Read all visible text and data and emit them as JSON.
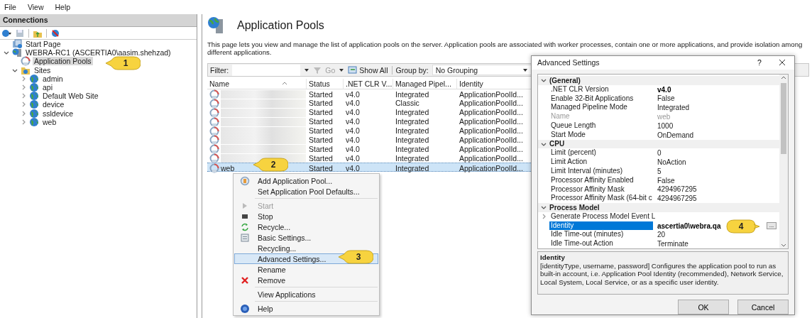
{
  "menu_bar": [
    "File",
    "View",
    "Help"
  ],
  "connections": {
    "title": "Connections",
    "tree": [
      {
        "label": "Start Page",
        "kind": "leaf",
        "selected": false
      },
      {
        "label": "WEBRA-RC1 (ASCERTIA0\\aasim.shehzad)",
        "kind": "node",
        "expanded": true,
        "selected": false,
        "children": [
          {
            "label": "Application Pools",
            "kind": "leaf",
            "selected": true
          },
          {
            "label": "Sites",
            "kind": "node",
            "expanded": true,
            "selected": false,
            "children": [
              {
                "label": "admin",
                "kind": "node",
                "expanded": false,
                "selected": false
              },
              {
                "label": "api",
                "kind": "node",
                "expanded": false,
                "selected": false
              },
              {
                "label": "Default Web Site",
                "kind": "node",
                "expanded": false,
                "selected": false
              },
              {
                "label": "device",
                "kind": "node",
                "expanded": false,
                "selected": false
              },
              {
                "label": "ssldevice",
                "kind": "node",
                "expanded": false,
                "selected": false
              },
              {
                "label": "web",
                "kind": "node",
                "expanded": false,
                "selected": false
              }
            ]
          }
        ]
      }
    ]
  },
  "page": {
    "title": "Application Pools",
    "description": "This page lets you view and manage the list of application pools on the server. Application pools are associated with worker processes, contain one or more applications, and provide isolation among different applications.",
    "filter": {
      "label": "Filter:",
      "go": "Go",
      "show_all": "Show All",
      "group_by_label": "Group by:",
      "group_by": "No Grouping"
    },
    "table": {
      "columns": [
        "Name",
        "Status",
        ".NET CLR V...",
        "Managed Pipel...",
        "Identity"
      ],
      "rows": [
        {
          "status": "Started",
          "clr": "v4.0",
          "pipeline": "Integrated",
          "identity": "ApplicationPoolId...",
          "selected": false
        },
        {
          "status": "Started",
          "clr": "v4.0",
          "pipeline": "Classic",
          "identity": "ApplicationPoolId...",
          "selected": false
        },
        {
          "status": "Started",
          "clr": "v4.0",
          "pipeline": "Integrated",
          "identity": "ApplicationPoolId...",
          "selected": false
        },
        {
          "status": "Started",
          "clr": "v4.0",
          "pipeline": "Integrated",
          "identity": "ApplicationPoolId...",
          "selected": false
        },
        {
          "status": "Started",
          "clr": "v4.0",
          "pipeline": "Integrated",
          "identity": "ApplicationPoolId...",
          "selected": false
        },
        {
          "status": "Started",
          "clr": "v4.0",
          "pipeline": "Integrated",
          "identity": "ApplicationPoolId...",
          "selected": false
        },
        {
          "status": "Started",
          "clr": "v4.0",
          "pipeline": "Integrated",
          "identity": "ApplicationPoolId...",
          "selected": false
        },
        {
          "status": "Started",
          "clr": "v4.0",
          "pipeline": "Integrated",
          "identity": "ApplicationPoolId...",
          "selected": false
        },
        {
          "name": "web",
          "status": "Started",
          "clr": "v4.0",
          "pipeline": "Integrated",
          "identity": "ApplicationPoolId...",
          "selected": true
        }
      ]
    }
  },
  "context_menu": [
    {
      "kind": "item",
      "label": "Add Application Pool...",
      "disabled": false,
      "selected": false
    },
    {
      "kind": "item",
      "label": "Set Application Pool Defaults...",
      "disabled": false,
      "selected": false
    },
    {
      "kind": "separator"
    },
    {
      "kind": "item",
      "label": "Start",
      "disabled": true,
      "selected": false
    },
    {
      "kind": "item",
      "label": "Stop",
      "disabled": false,
      "selected": false
    },
    {
      "kind": "item",
      "label": "Recycle...",
      "disabled": false,
      "selected": false
    },
    {
      "kind": "item",
      "label": "Basic Settings...",
      "disabled": false,
      "selected": false
    },
    {
      "kind": "item",
      "label": "Recycling...",
      "disabled": false,
      "selected": false
    },
    {
      "kind": "item",
      "label": "Advanced Settings...",
      "disabled": false,
      "selected": true
    },
    {
      "kind": "item",
      "label": "Rename",
      "disabled": false,
      "selected": false
    },
    {
      "kind": "item",
      "label": "Remove",
      "disabled": false,
      "selected": false
    },
    {
      "kind": "separator"
    },
    {
      "kind": "item",
      "label": "View Applications",
      "disabled": false,
      "selected": false
    },
    {
      "kind": "separator"
    },
    {
      "kind": "item",
      "label": "Help",
      "disabled": false,
      "selected": false
    }
  ],
  "dialog": {
    "title": "Advanced Settings",
    "help": "?",
    "groups": [
      {
        "title": "(General)",
        "expanded": true,
        "properties": [
          {
            "kind": "property",
            "name": ".NET CLR Version",
            "value": "v4.0",
            "modified": true,
            "disabled": false,
            "selected": false
          },
          {
            "kind": "property",
            "name": "Enable 32-Bit Applications",
            "value": "False",
            "modified": false,
            "disabled": false,
            "selected": false
          },
          {
            "kind": "property",
            "name": "Managed Pipeline Mode",
            "value": "Integrated",
            "modified": false,
            "disabled": false,
            "selected": false
          },
          {
            "kind": "property",
            "name": "Name",
            "value": "web",
            "modified": false,
            "disabled": true,
            "selected": false
          },
          {
            "kind": "property",
            "name": "Queue Length",
            "value": "1000",
            "modified": false,
            "disabled": false,
            "selected": false
          },
          {
            "kind": "property",
            "name": "Start Mode",
            "value": "OnDemand",
            "modified": false,
            "disabled": false,
            "selected": false
          }
        ]
      },
      {
        "title": "CPU",
        "expanded": true,
        "properties": [
          {
            "kind": "property",
            "name": "Limit (percent)",
            "value": "0",
            "modified": false,
            "disabled": false,
            "selected": false
          },
          {
            "kind": "property",
            "name": "Limit Action",
            "value": "NoAction",
            "modified": false,
            "disabled": false,
            "selected": false
          },
          {
            "kind": "property",
            "name": "Limit Interval (minutes)",
            "value": "5",
            "modified": false,
            "disabled": false,
            "selected": false
          },
          {
            "kind": "property",
            "name": "Processor Affinity Enabled",
            "value": "False",
            "modified": false,
            "disabled": false,
            "selected": false
          },
          {
            "kind": "property",
            "name": "Processor Affinity Mask",
            "value": "4294967295",
            "modified": false,
            "disabled": false,
            "selected": false
          },
          {
            "kind": "property",
            "name": "Processor Affinity Mask (64-bit c",
            "value": "4294967295",
            "modified": false,
            "disabled": false,
            "selected": false
          }
        ]
      },
      {
        "title": "Process Model",
        "expanded": true,
        "properties": [
          {
            "kind": "expander",
            "name": "Generate Process Model Event L",
            "disabled": false,
            "selected": false
          },
          {
            "kind": "browse",
            "name": "Identity",
            "value": "ascertia0\\webra.qa",
            "button": "...",
            "modified": true,
            "disabled": false,
            "selected": true
          },
          {
            "kind": "property",
            "name": "Idle Time-out (minutes)",
            "value": "20",
            "modified": false,
            "disabled": false,
            "selected": false
          },
          {
            "kind": "property",
            "name": "Idle Time-out Action",
            "value": "Terminate",
            "modified": false,
            "disabled": false,
            "selected": false
          }
        ]
      }
    ],
    "help_title": "Identity",
    "help_text": "[identityType, username, password] Configures the application pool to run as built-in account, i.e. Application Pool Identity (recommended), Network Service, Local System, Local Service, or as a specific user identity.",
    "buttons": [
      "OK",
      "Cancel"
    ]
  },
  "callouts": [
    {
      "text": "1",
      "kind": "left"
    },
    {
      "text": "2",
      "kind": "left"
    },
    {
      "text": "3",
      "kind": "left"
    },
    {
      "text": "4",
      "kind": "right"
    }
  ]
}
